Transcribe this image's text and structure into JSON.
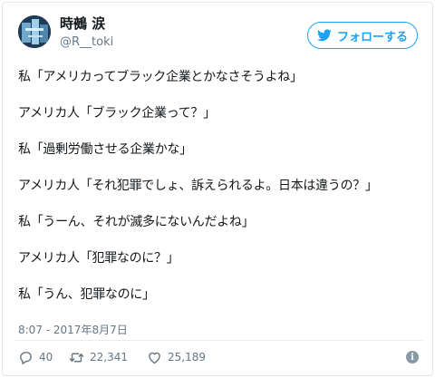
{
  "user": {
    "display_name": "時鵺 涙",
    "handle": "@R__toki"
  },
  "follow_button": {
    "label": "フォローする",
    "icon": "twitter-bird-icon"
  },
  "tweet": {
    "lines": [
      "私「アメリカってブラック企業とかなさそうよね」",
      "",
      "アメリカ人「ブラック企業って？」",
      "",
      "私「過剰労働させる企業かな」",
      "",
      "アメリカ人「それ犯罪でしょ、訴えられるよ。日本は違うの？」",
      "",
      "私「うーん、それが滅多にないんだよね」",
      "",
      "アメリカ人「犯罪なのに？」",
      "",
      "私「うん、犯罪なのに」"
    ],
    "timestamp": "8:07 - 2017年8月7日"
  },
  "actions": {
    "replies": "40",
    "retweets": "22,341",
    "likes": "25,189"
  },
  "colors": {
    "accent": "#1da1f2",
    "muted": "#657786",
    "text": "#14171a"
  }
}
